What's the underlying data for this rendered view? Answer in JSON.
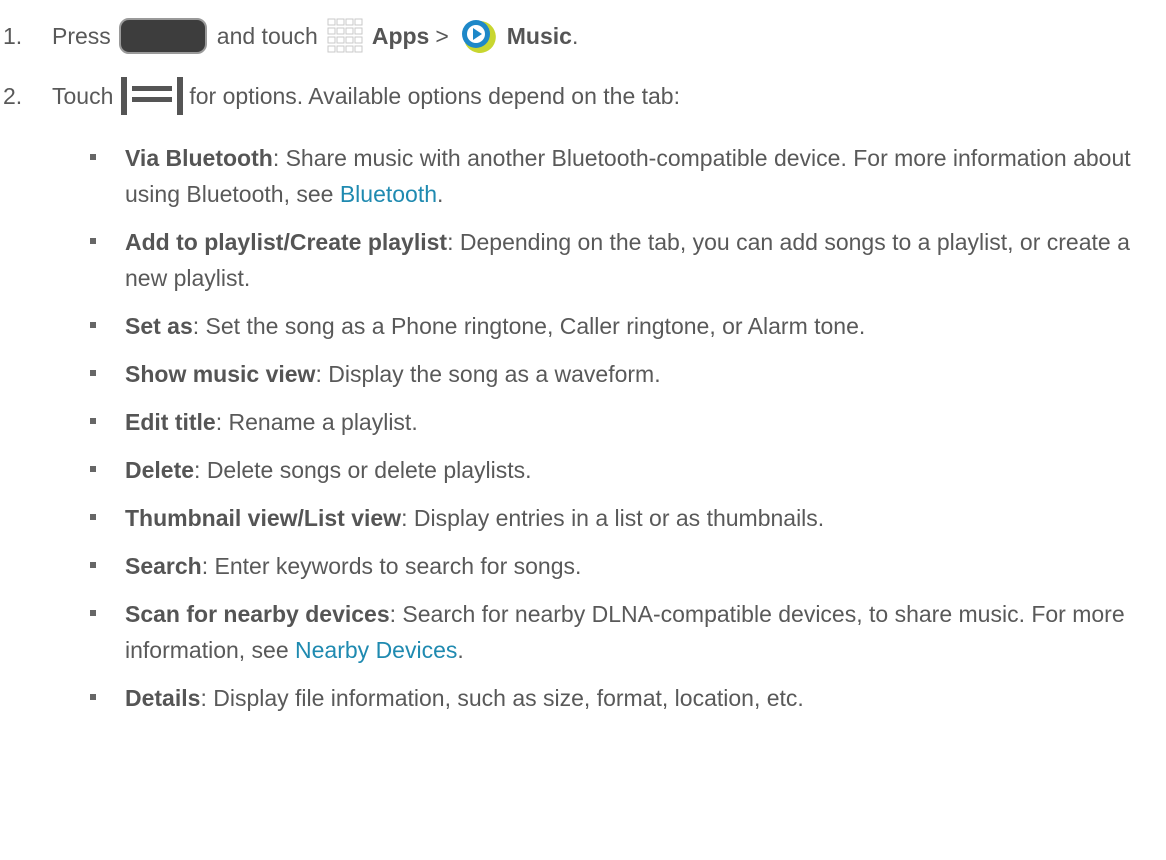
{
  "steps": [
    {
      "number": "1.",
      "text_press": "Press",
      "text_and_touch": "and touch",
      "apps_label": "Apps",
      "separator": ">",
      "music_label": "Music",
      "period": "."
    },
    {
      "number": "2.",
      "text_touch": "Touch",
      "text_rest": "for options. Available options depend on the tab:"
    }
  ],
  "options": [
    {
      "term": "Via Bluetooth",
      "desc": ": Share music with another Bluetooth-compatible device. For more information about using Bluetooth, see ",
      "link": "Bluetooth",
      "tail": "."
    },
    {
      "term": "Add to playlist/Create playlist",
      "desc": ": Depending on the tab, you can add songs to a playlist, or create a new playlist."
    },
    {
      "term": "Set as",
      "desc": ": Set the song as a Phone ringtone, Caller ringtone, or Alarm tone."
    },
    {
      "term": "Show music view",
      "desc": ": Display the song as a waveform."
    },
    {
      "term": "Edit title",
      "desc": ": Rename a playlist."
    },
    {
      "term": "Delete",
      "desc": ": Delete songs or delete playlists."
    },
    {
      "term": "Thumbnail view/List view",
      "desc": ": Display entries in a list or as thumbnails."
    },
    {
      "term": "Search",
      "desc": ": Enter keywords to search for songs."
    },
    {
      "term": "Scan for nearby devices",
      "desc": ": Search for nearby DLNA-compatible devices, to share music. For more information, see ",
      "link": "Nearby Devices",
      "tail": "."
    },
    {
      "term": "Details",
      "desc": ": Display file information, such as size, format, location, etc."
    }
  ],
  "icons": {
    "home_button": "home-button-icon",
    "apps": "apps-grid-icon",
    "music": "music-player-icon",
    "menu": "menu-icon"
  },
  "colors": {
    "text": "#595959",
    "link": "#1f8ab0",
    "music_icon_blue": "#1e88c8",
    "music_icon_yellow": "#c8d630"
  }
}
